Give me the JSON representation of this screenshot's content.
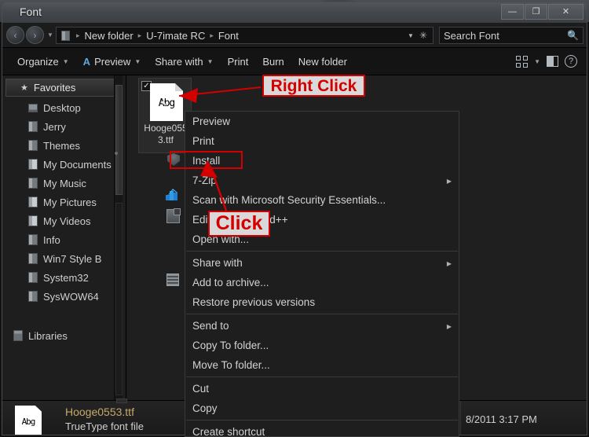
{
  "window": {
    "title": "Font",
    "buttons": {
      "minimize": "—",
      "maximize": "❐",
      "close": "✕"
    }
  },
  "address_bar": {
    "back_icon": "‹",
    "forward_icon": "›",
    "history_caret": "▼",
    "crumbs": [
      "New folder",
      "U-7imate RC",
      "Font"
    ],
    "separator": "▸",
    "dropdown_icon": "▼",
    "refresh_icon": "✳",
    "search_placeholder": "Search Font",
    "search_value": "",
    "search_icon": "search-icon"
  },
  "toolbar": {
    "items": [
      {
        "label": "Organize",
        "caret": "▼",
        "icon": ""
      },
      {
        "label": "Preview",
        "caret": "▼",
        "icon": "A"
      },
      {
        "label": "Share with",
        "caret": "▼",
        "icon": ""
      },
      {
        "label": "Print",
        "caret": "",
        "icon": ""
      },
      {
        "label": "Burn",
        "caret": "",
        "icon": ""
      },
      {
        "label": "New folder",
        "caret": "",
        "icon": ""
      }
    ],
    "view_caret": "▼",
    "help_label": "?"
  },
  "sidebar": {
    "header": {
      "label": "Favorites",
      "star": "★"
    },
    "items": [
      {
        "label": "Desktop",
        "icon": "desktop-icon"
      },
      {
        "label": "Jerry",
        "icon": "folder-icon"
      },
      {
        "label": "Themes",
        "icon": "folder-icon"
      },
      {
        "label": "My Documents",
        "icon": "folder-icon"
      },
      {
        "label": "My Music",
        "icon": "folder-icon"
      },
      {
        "label": "My Pictures",
        "icon": "folder-icon"
      },
      {
        "label": "My Videos",
        "icon": "folder-icon"
      },
      {
        "label": "Info",
        "icon": "folder-icon"
      },
      {
        "label": "Win7 Style B",
        "icon": "folder-icon"
      },
      {
        "label": "System32",
        "icon": "folder-icon"
      },
      {
        "label": "SysWOW64",
        "icon": "folder-icon"
      }
    ],
    "libraries": {
      "label": "Libraries",
      "icon": "library-icon"
    }
  },
  "file_pane": {
    "item": {
      "checkbox": "✓",
      "glyph_text": "Abg",
      "label": "Hooge0553.ttf",
      "selected": true
    }
  },
  "context_menu": {
    "groups": [
      {
        "items": [
          {
            "label": "Preview",
            "submenu": false,
            "icon": ""
          },
          {
            "label": "Print",
            "submenu": false,
            "icon": ""
          },
          {
            "label": "Install",
            "submenu": false,
            "icon": "shield-icon"
          },
          {
            "label": "7-Zip",
            "submenu": true,
            "icon": ""
          },
          {
            "label": "Scan with Microsoft Security Essentials...",
            "submenu": false,
            "icon": "mse-icon"
          },
          {
            "label": "Edit with Notepad++",
            "submenu": false,
            "icon": "notepad-icon"
          },
          {
            "label": "Open with...",
            "submenu": false,
            "icon": ""
          }
        ]
      },
      {
        "items": [
          {
            "label": "Share with",
            "submenu": true,
            "icon": ""
          },
          {
            "label": "Add to archive...",
            "submenu": false,
            "icon": "archive-icon"
          },
          {
            "label": "Restore previous versions",
            "submenu": false,
            "icon": ""
          }
        ]
      },
      {
        "items": [
          {
            "label": "Send to",
            "submenu": true,
            "icon": ""
          },
          {
            "label": "Copy To folder...",
            "submenu": false,
            "icon": ""
          },
          {
            "label": "Move To folder...",
            "submenu": false,
            "icon": ""
          }
        ]
      },
      {
        "items": [
          {
            "label": "Cut",
            "submenu": false,
            "icon": ""
          },
          {
            "label": "Copy",
            "submenu": false,
            "icon": ""
          }
        ]
      },
      {
        "items": [
          {
            "label": "Create shortcut",
            "submenu": false,
            "icon": ""
          }
        ]
      }
    ],
    "submenu_arrow": "▶"
  },
  "annotations": {
    "right_click": "Right Click",
    "click": "Click",
    "highlight_color": "#d40000",
    "label_background": "#d9d9d9"
  },
  "status_bar": {
    "glyph_text": "Abg",
    "file_name": "Hooge0553.ttf",
    "file_type": "TrueType font file",
    "date_modified": "8/2011 3:17 PM"
  }
}
